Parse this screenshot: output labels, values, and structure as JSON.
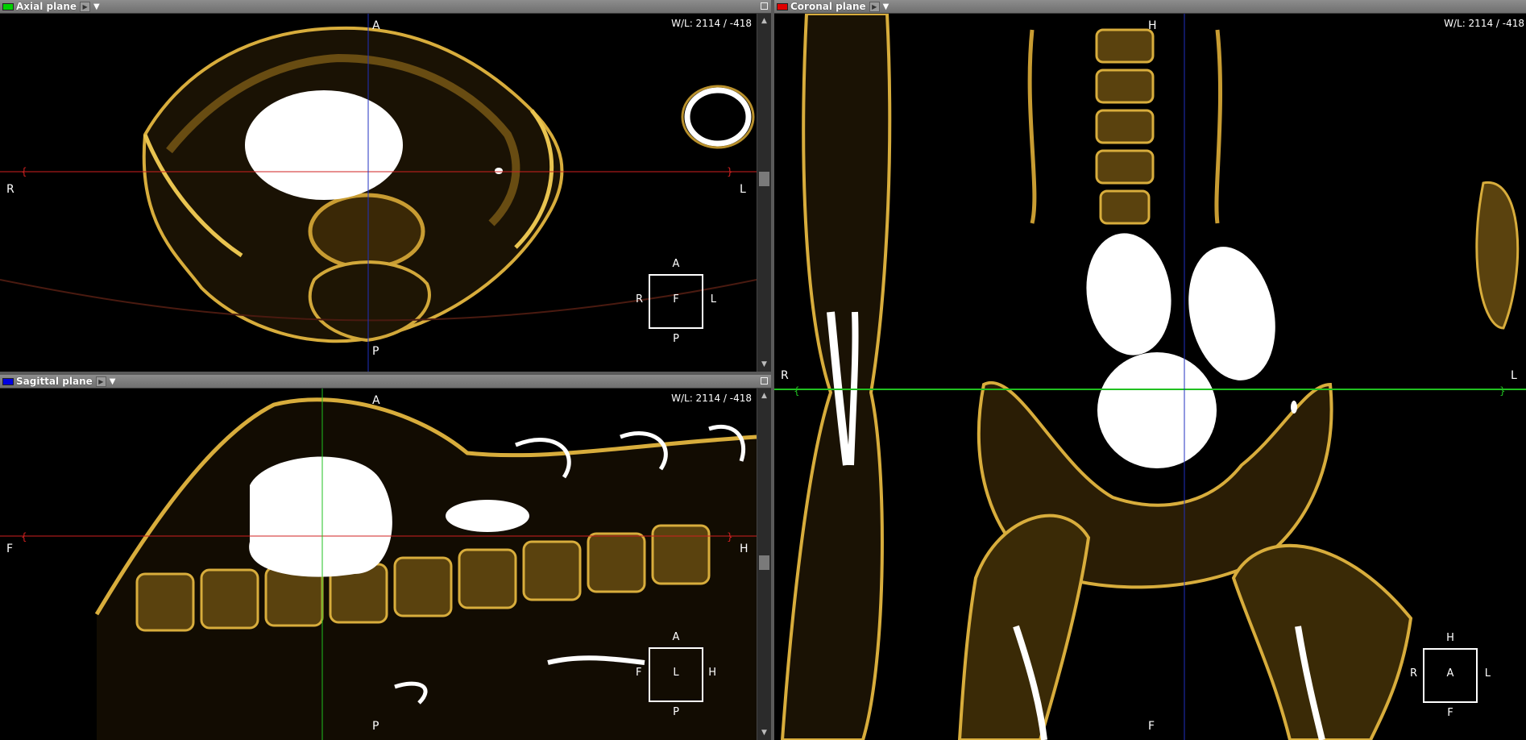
{
  "panels": {
    "axial": {
      "title": "Axial plane",
      "chip_color": "#00d000",
      "wl": "W/L: 2114 / -418",
      "orient": {
        "top": "A",
        "bottom": "P",
        "left": "R",
        "right": "L"
      },
      "cube": {
        "center": "F",
        "top": "A",
        "bottom": "P",
        "left": "R",
        "right": "L"
      }
    },
    "sagittal": {
      "title": "Sagittal plane",
      "chip_color": "#0000e0",
      "wl": "W/L: 2114 / -418",
      "orient": {
        "top": "A",
        "bottom": "P",
        "left": "F",
        "right": "H"
      },
      "cube": {
        "center": "L",
        "top": "A",
        "bottom": "P",
        "left": "F",
        "right": "H"
      }
    },
    "coronal": {
      "title": "Coronal plane",
      "chip_color": "#e00000",
      "wl": "W/L: 2114 / -418",
      "orient": {
        "top": "H",
        "bottom": "F",
        "left": "R",
        "right": "L"
      },
      "cube": {
        "center": "A",
        "top": "H",
        "bottom": "F",
        "left": "R",
        "right": "L"
      }
    }
  },
  "icons": {
    "play": "play-icon",
    "dropdown": "dropdown-icon",
    "maximize": "maximize-icon"
  },
  "colors": {
    "bone": "#c9a23a",
    "axial_line": "#d02020",
    "sagittal_line": "#2030c0",
    "coronal_line": "#20c020"
  }
}
